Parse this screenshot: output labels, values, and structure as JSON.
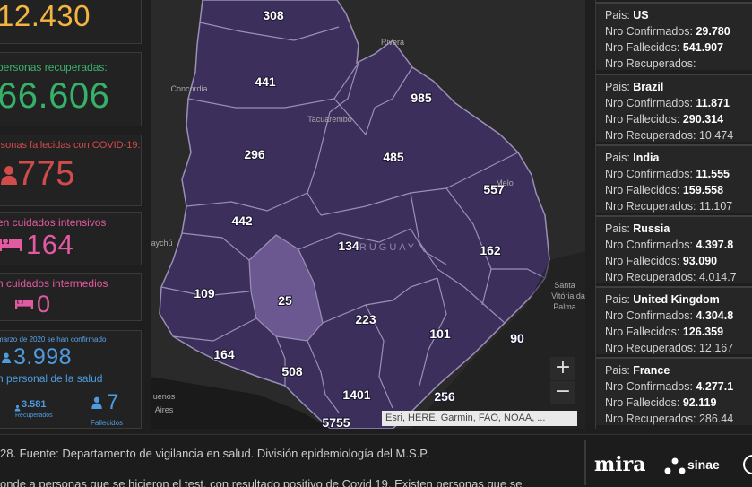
{
  "stats": {
    "top_value": "12.430",
    "recovered_label": "personas recuperadas:",
    "recovered_value": "66.606",
    "deaths_label": "rsonas fallecidas con COVID-19:",
    "deaths_value": "775",
    "icu_label": "en cuidados intensivos",
    "icu_value": "164",
    "intermediate_label": "n cuidados intermedios",
    "intermediate_value": "0",
    "health_intro": "marzo de 2020 se han confirmado",
    "health_value": "3.998",
    "health_label": "n personal de la salud",
    "health_recovered_value": "3.581",
    "health_recovered_label": "Recuperados",
    "health_deaths_value": "7",
    "health_deaths_label": "Fallecidos"
  },
  "map": {
    "departments": [
      "308",
      "441",
      "985",
      "296",
      "485",
      "557",
      "442",
      "134",
      "162",
      "109",
      "25",
      "223",
      "101",
      "90",
      "164",
      "508",
      "1401",
      "256",
      "5755"
    ],
    "places": [
      "Rivera",
      "Concordia",
      "Tacuarembó",
      "Melo",
      "RUGUAY",
      "uaychú",
      "Santa",
      "Vitória da",
      "Palma",
      "uenos",
      "Aires"
    ],
    "zoom_in": "+",
    "zoom_out": "−",
    "attribution": "Esri, HERE, Garmin, FAO, NOAA, ...",
    "colors": {
      "region": "#3d2f5b",
      "highlight": "#6b5891",
      "border": "#9a90b6"
    }
  },
  "countries": [
    {
      "pais_label": "Pais:",
      "name": "US",
      "confirmed_label": "Nro Confirmados:",
      "confirmed": "29.780",
      "deaths_label": "Nro Fallecidos:",
      "deaths": "541.907",
      "recovered_label": "Nro Recuperados:",
      "recovered": ""
    },
    {
      "pais_label": "Pais:",
      "name": "Brazil",
      "confirmed_label": "Nro Confirmados:",
      "confirmed": "11.871",
      "deaths_label": "Nro Fallecidos:",
      "deaths": "290.314",
      "recovered_label": "Nro Recuperados:",
      "recovered": "10.474"
    },
    {
      "pais_label": "Pais:",
      "name": "India",
      "confirmed_label": "Nro Confirmados:",
      "confirmed": "11.555",
      "deaths_label": "Nro Fallecidos:",
      "deaths": "159.558",
      "recovered_label": "Nro Recuperados:",
      "recovered": "11.107"
    },
    {
      "pais_label": "Pais:",
      "name": "Russia",
      "confirmed_label": "Nro Confirmados:",
      "confirmed": "4.397.8",
      "deaths_label": "Nro Fallecidos:",
      "deaths": "93.090",
      "recovered_label": "Nro Recuperados:",
      "recovered": "4.014.7"
    },
    {
      "pais_label": "Pais:",
      "name": "United Kingdom",
      "confirmed_label": "Nro Confirmados:",
      "confirmed": "4.304.8",
      "deaths_label": "Nro Fallecidos:",
      "deaths": "126.359",
      "recovered_label": "Nro Recuperados:",
      "recovered": "12.167"
    },
    {
      "pais_label": "Pais:",
      "name": "France",
      "confirmed_label": "Nro Confirmados:",
      "confirmed": "4.277.1",
      "deaths_label": "Nro Fallecidos:",
      "deaths": "92.119",
      "recovered_label": "Nro Recuperados:",
      "recovered": "286.44"
    }
  ],
  "footer": {
    "source": "28. Fuente: Departamento de vigilancia en salud. División epidemiología del M.S.P.",
    "note": "onde a personas que se hicieron el test, con resultado positivo de Covid 19. Existen personas que se",
    "logo_mira": "mira",
    "logo_sinae": "sinae"
  }
}
